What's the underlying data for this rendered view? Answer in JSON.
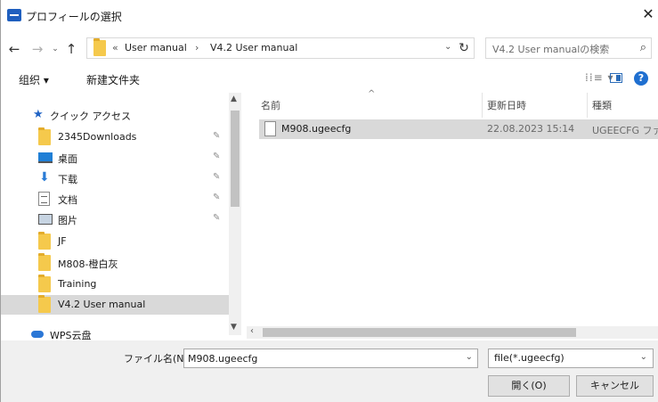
{
  "window": {
    "title": "プロフィールの選択",
    "close_glyph": "✕"
  },
  "nav": {
    "back": "←",
    "forward": "→",
    "recent": "⌄",
    "up": "↑"
  },
  "address": {
    "more": "«",
    "crumbs": [
      "User manual",
      "V4.2 User manual"
    ],
    "separator": "›",
    "dropdown": "⌄",
    "refresh": "↻"
  },
  "search": {
    "placeholder": "V4.2 User manualの検索"
  },
  "toolbar": {
    "organize": "组织 ▾",
    "new_folder": "新建文件夹",
    "view": "⁞⁞≡ ▾",
    "help": "?"
  },
  "sidebar": {
    "quick_access": "クイック アクセス",
    "items": [
      {
        "label": "2345Downloads",
        "icon": "folder-icon",
        "pinned": true
      },
      {
        "label": "桌面",
        "icon": "desktop-icon",
        "pinned": true
      },
      {
        "label": "下载",
        "icon": "download-icon",
        "pinned": true
      },
      {
        "label": "文档",
        "icon": "document-icon",
        "pinned": true
      },
      {
        "label": "图片",
        "icon": "pictures-icon",
        "pinned": true
      },
      {
        "label": "JF",
        "icon": "folder-icon",
        "pinned": false
      },
      {
        "label": "M808-橙白灰",
        "icon": "folder-icon",
        "pinned": false
      },
      {
        "label": "Training",
        "icon": "folder-icon",
        "pinned": false
      },
      {
        "label": "V4.2 User manual",
        "icon": "folder-icon",
        "pinned": false,
        "selected": true
      }
    ],
    "wps": "WPS云盘",
    "pin_glyph": "📌"
  },
  "columns": {
    "name": "名前",
    "date": "更新日時",
    "type": "種類",
    "sort_glyph": "^"
  },
  "files": [
    {
      "name": "M908.ugeecfg",
      "date": "22.08.2023 15:14",
      "type": "UGEECFG ファイル"
    }
  ],
  "footer": {
    "filename_label": "ファイル名(N):",
    "filename_value": "M908.ugeecfg",
    "filter": "file(*.ugeecfg)",
    "open": "開く(O)",
    "cancel": "キャンセル"
  },
  "colors": {
    "accent": "#1f6fd0",
    "selection": "#d9d9d9",
    "folder": "#f5c94c"
  }
}
